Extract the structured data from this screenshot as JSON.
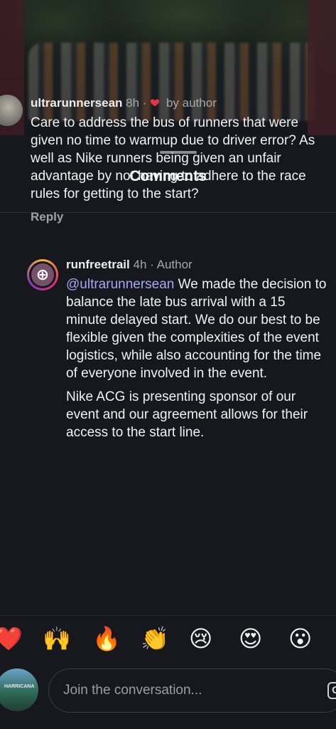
{
  "sheet": {
    "title": "Comments"
  },
  "comments": [
    {
      "username": "ultrarunnersean",
      "time": "8h",
      "separator": "·",
      "liked_label": "by author",
      "text": "Care to address the bus of runners that were given no time to warmup due to driver error? As well as Nike runners being given an unfair advantage by not having to adhere to the race rules for getting to the start?",
      "reply_label": "Reply"
    }
  ],
  "replies": [
    {
      "username": "runfreetrail",
      "time": "4h",
      "separator": "·",
      "role": "Author",
      "mention": "@ultrarunnersean",
      "text_1": " We made the decision to balance the late bus arrival with a 15 minute delayed start. We do our best to be flexible given the complexities of the event logistics, while also accounting for the time of everyone involved in the event.",
      "text_2": "Nike ACG is presenting sponsor of our event and our agreement allows for their access to the start line."
    }
  ],
  "reactions": [
    "❤️",
    "🙌",
    "🔥",
    "👏",
    "😢",
    "😍",
    "😮"
  ],
  "composer": {
    "placeholder": "Join the conversation...",
    "gif_label": "G",
    "avatar_text": "HARRICANA"
  },
  "colors": {
    "heart": "#e8344b",
    "mention": "#a6a8f5",
    "background": "#16181d"
  },
  "icons": {
    "heart": "heart-icon",
    "gif": "gif-icon"
  }
}
